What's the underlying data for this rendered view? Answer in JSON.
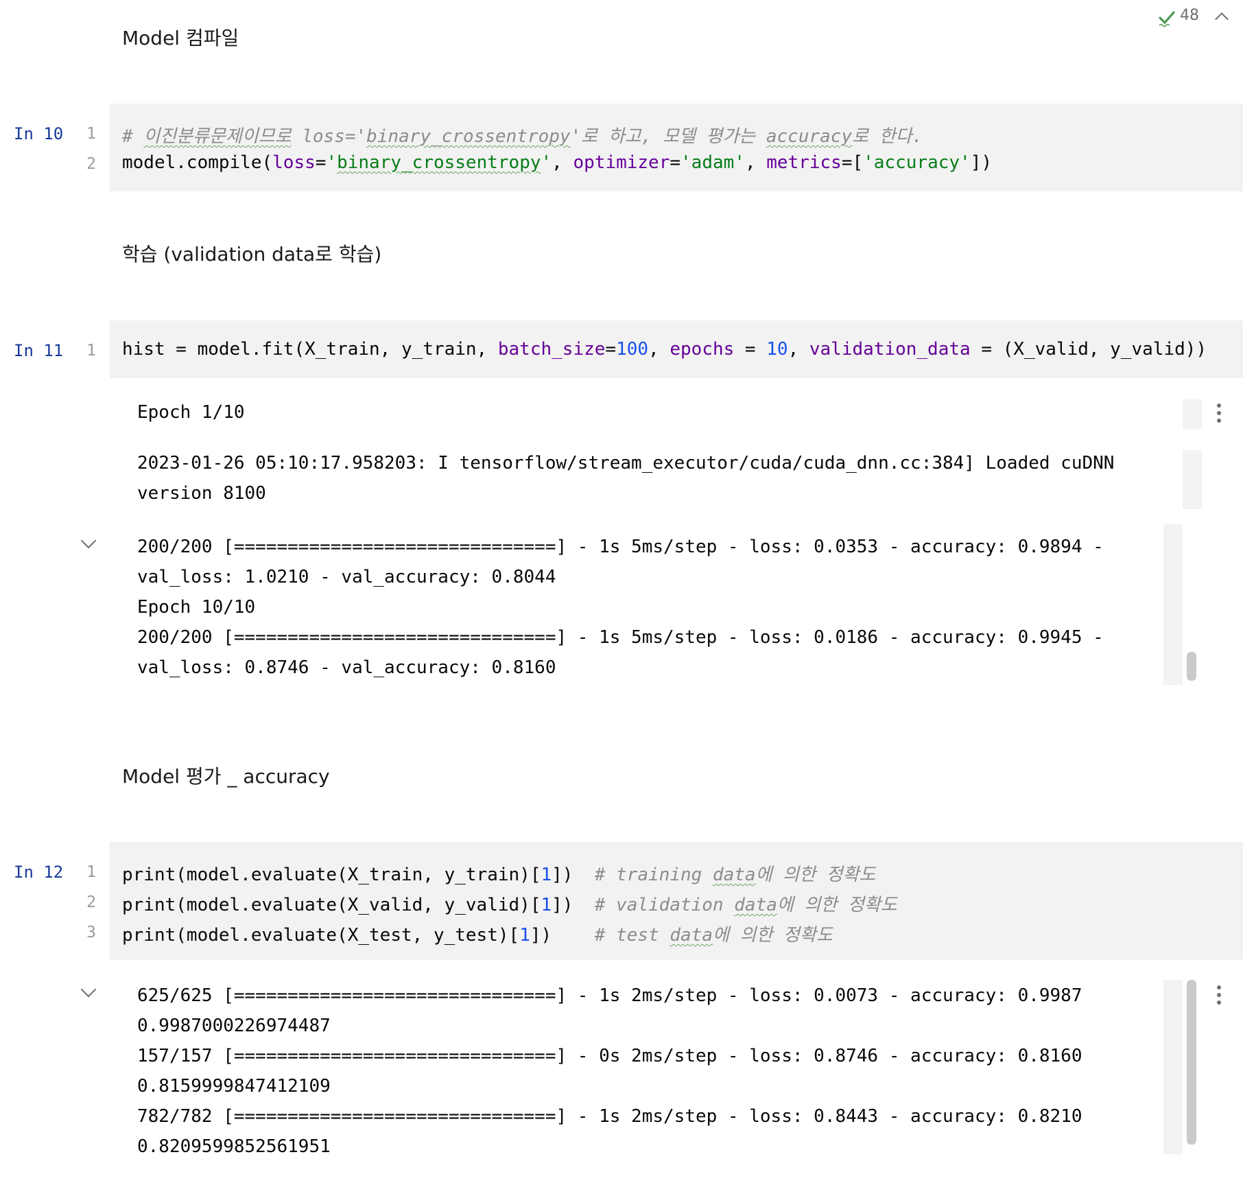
{
  "indicator": {
    "count": "48"
  },
  "headings": {
    "compile": "Model 컴파일",
    "train": "학습 (validation data로 학습)",
    "evaluate": "Model 평가 _ accuracy"
  },
  "cells": [
    {
      "prompt": "In 10",
      "line_numbers": [
        "1",
        "2"
      ],
      "code": {
        "comment_prefix": "# ",
        "comment_word1": "이진분류문제이므로",
        "comment_mid": " loss='",
        "comment_word2": "binary_crossentropy",
        "comment_rest": "'로 하고, 모델 평가는 ",
        "comment_word3": "accuracy",
        "comment_end": "로 한다.",
        "l2_a": "model.compile(",
        "l2_kw1": "loss",
        "l2_eq1": "=",
        "l2_str1a": "'",
        "l2_str1b": "binary_crossentropy",
        "l2_str1c": "'",
        "l2_sep1": ", ",
        "l2_kw2": "optimizer",
        "l2_eq2": "=",
        "l2_str2": "'adam'",
        "l2_sep2": ", ",
        "l2_kw3": "metrics",
        "l2_eq3": "=[",
        "l2_str3": "'accuracy'",
        "l2_end": "])"
      }
    },
    {
      "prompt": "In 11",
      "line_numbers": [
        "1"
      ],
      "code": {
        "a": "hist = model.fit(X_train, y_train, ",
        "kw1": "batch_size",
        "eq1": "=",
        "num1": "100",
        "sep1": ", ",
        "kw2": "epochs",
        "eq2": " = ",
        "num2": "10",
        "sep2": ", ",
        "kw3": "validation_data",
        "end": " = (X_valid, y_valid))"
      },
      "output": {
        "epoch1": "Epoch 1/10",
        "log1": "2023-01-26 05:10:17.958203: I tensorflow/stream_executor/cuda/cuda_dnn.cc:384] Loaded cuDNN",
        "log2": "version 8100",
        "lines": [
          "200/200 [==============================] - 1s 5ms/step - loss: 0.0353 - accuracy: 0.9894 -",
          "val_loss: 1.0210 - val_accuracy: 0.8044",
          "Epoch 10/10",
          "200/200 [==============================] - 1s 5ms/step - loss: 0.0186 - accuracy: 0.9945 -",
          "val_loss: 0.8746 - val_accuracy: 0.8160"
        ]
      }
    },
    {
      "prompt": "In 12",
      "line_numbers": [
        "1",
        "2",
        "3"
      ],
      "code": {
        "l1_a": "print(model.evaluate(X_train, y_train)[",
        "l1_num": "1",
        "l1_b": "])",
        "l1_pad": "  ",
        "l1_c1": "# training ",
        "l1_c2": "data",
        "l1_c3": "에 의한 정확도",
        "l2_a": "print(model.evaluate(X_valid, y_valid)[",
        "l2_num": "1",
        "l2_b": "])",
        "l2_pad": "  ",
        "l2_c1": "# validation ",
        "l2_c2": "data",
        "l2_c3": "에 의한 정확도",
        "l3_a": "print(model.evaluate(X_test, y_test)[",
        "l3_num": "1",
        "l3_b": "])",
        "l3_pad": "    ",
        "l3_c1": "# test ",
        "l3_c2": "data",
        "l3_c3": "에 의한 정확도"
      },
      "output": {
        "lines": [
          "625/625 [==============================] - 1s 2ms/step - loss: 0.0073 - accuracy: 0.9987",
          "0.9987000226974487",
          "157/157 [==============================] - 0s 2ms/step - loss: 0.8746 - accuracy: 0.8160",
          "0.8159999847412109",
          "782/782 [==============================] - 1s 2ms/step - loss: 0.8443 - accuracy: 0.8210",
          "0.8209599852561951"
        ]
      }
    }
  ]
}
